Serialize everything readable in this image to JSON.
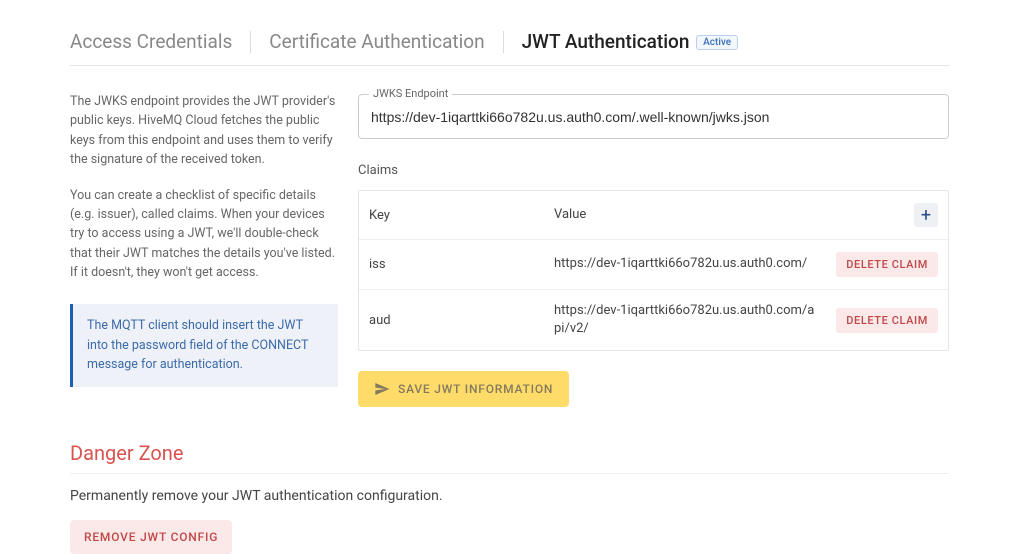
{
  "tabs": {
    "access": "Access Credentials",
    "cert": "Certificate Authentication",
    "jwt": "JWT Authentication",
    "badge": "Active"
  },
  "help": {
    "p1": "The JWKS endpoint provides the JWT provider's public keys. HiveMQ Cloud fetches the public keys from this endpoint and uses them to verify the signature of the received token.",
    "p2": "You can create a checklist of specific details (e.g. issuer), called claims. When your devices try to access using a JWT, we'll double-check that their JWT matches the details you've listed. If it doesn't, they won't get access.",
    "info": "The MQTT client should insert the JWT into the password field of the CONNECT message for authentication."
  },
  "jwks": {
    "label": "JWKS Endpoint",
    "value": "https://dev-1iqarttki66o782u.us.auth0.com/.well-known/jwks.json"
  },
  "claims": {
    "title": "Claims",
    "headers": {
      "key": "Key",
      "value": "Value"
    },
    "rows": [
      {
        "key": "iss",
        "value": "https://dev-1iqarttki66o782u.us.auth0.com/"
      },
      {
        "key": "aud",
        "value": "https://dev-1iqarttki66o782u.us.auth0.com/api/v2/"
      }
    ],
    "delete_label": "DELETE CLAIM"
  },
  "save_label": "SAVE JWT INFORMATION",
  "danger": {
    "heading": "Danger Zone",
    "text": "Permanently remove your JWT authentication configuration.",
    "remove_label": "REMOVE JWT CONFIG"
  }
}
